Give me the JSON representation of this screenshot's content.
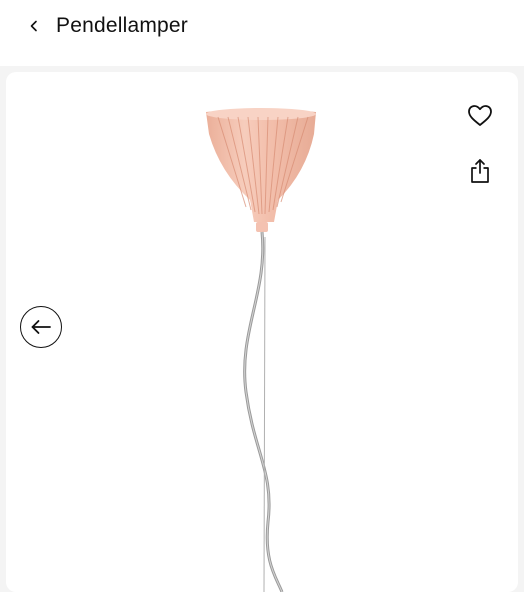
{
  "header": {
    "title": "Pendellamper",
    "back_icon": "chevron-left-icon"
  },
  "product": {
    "image_icons": {
      "favorite": "heart-icon",
      "share": "share-icon",
      "previous": "arrow-left-icon"
    },
    "shade_color": "#f2b9a4",
    "cable_color": "#9a9a9a"
  }
}
